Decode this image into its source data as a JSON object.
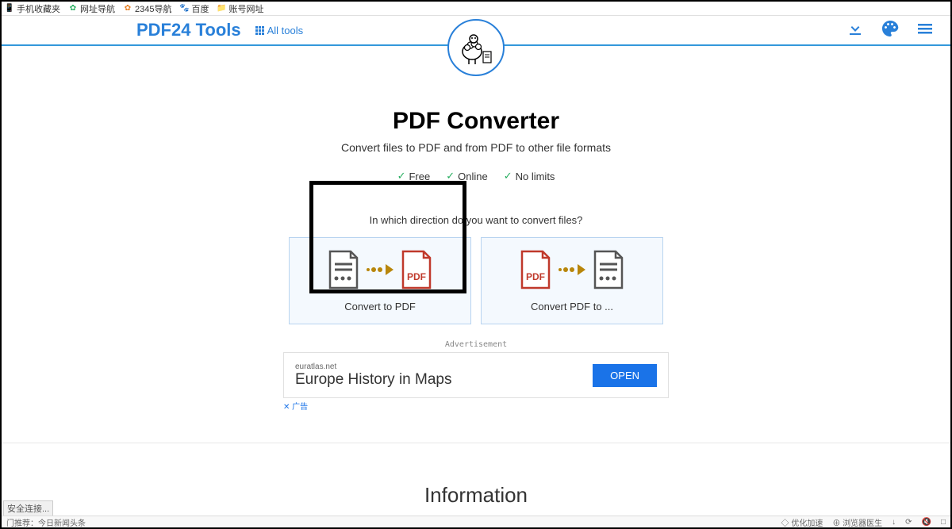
{
  "bookmarks": [
    {
      "icon": "📱",
      "label": "手机收藏夹",
      "color": "#3498db"
    },
    {
      "icon": "⚙",
      "label": "网址导航",
      "color": "#27ae60"
    },
    {
      "icon": "⚙",
      "label": "2345导航",
      "color": "#e67e22"
    },
    {
      "icon": "🐾",
      "label": "百度",
      "color": "#3498db"
    },
    {
      "icon": "📁",
      "label": "账号网址",
      "color": "#f39c12"
    }
  ],
  "header": {
    "brand": "PDF24 Tools",
    "all_tools": "All tools"
  },
  "main": {
    "title": "PDF Converter",
    "subtitle": "Convert files to PDF and from PDF to other file formats",
    "features": [
      "Free",
      "Online",
      "No limits"
    ],
    "question": "In which direction do you want to convert files?",
    "options": [
      {
        "label": "Convert to PDF"
      },
      {
        "label": "Convert PDF to ..."
      }
    ]
  },
  "ad": {
    "label": "Advertisement",
    "domain": "euratlas.net",
    "title": "Europe History in Maps",
    "button": "OPEN",
    "close": "✕ 广告"
  },
  "info": {
    "title": "Information"
  },
  "status": "安全连接...",
  "bottom": {
    "left": "门推荐：今日新闻头条",
    "items": [
      "优化加速",
      "浏览器医生",
      "↓",
      "⟳",
      "🔇",
      "□"
    ]
  }
}
